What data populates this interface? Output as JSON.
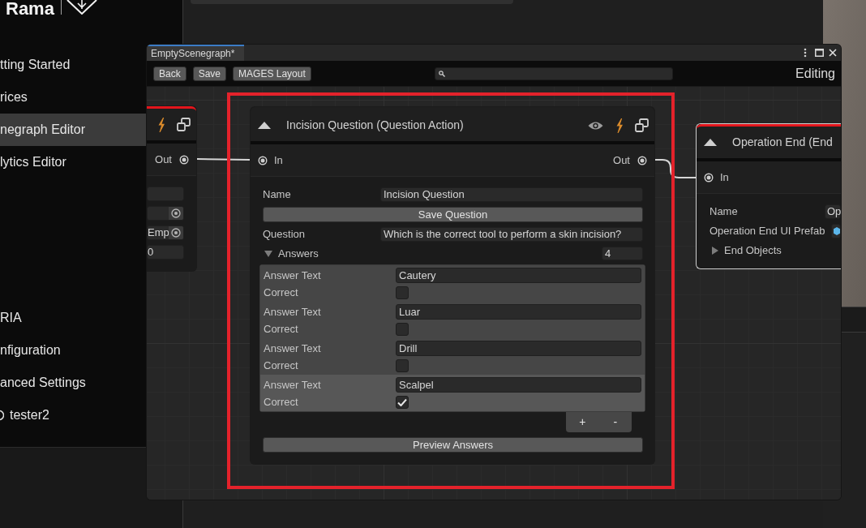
{
  "sidebar": {
    "logo_text": "Rama",
    "sections": [
      {
        "items": [
          {
            "kind": "link",
            "label": "tting Started",
            "selected": false
          },
          {
            "kind": "link",
            "label": "rices",
            "selected": false
          },
          {
            "kind": "link",
            "label": "negraph Editor",
            "selected": true
          },
          {
            "kind": "link",
            "label": "lytics Editor",
            "selected": false
          }
        ]
      },
      {
        "items": [
          {
            "kind": "link",
            "label": "RIA",
            "selected": false
          },
          {
            "kind": "link",
            "label": "nfiguration",
            "selected": false
          },
          {
            "kind": "link",
            "label": "anced Settings",
            "selected": false
          },
          {
            "kind": "user",
            "label": "tester2",
            "selected": false
          }
        ]
      }
    ]
  },
  "window": {
    "tab": "EmptyScenegraph*",
    "toolbar_buttons": [
      "Back",
      "Save",
      "MAGES Layout"
    ],
    "mode": "Editing"
  },
  "graph": {
    "nodes": [
      {
        "marked": true,
        "selected": false,
        "header_icons": [
          {
            "kind": "event"
          },
          {
            "kind": "prefab"
          }
        ],
        "ports": {
          "out": "Out"
        },
        "fields": [
          {
            "kind": "text"
          },
          {
            "kind": "object",
            "picker": true
          },
          {
            "kind": "object",
            "value": "Emp",
            "picker": true
          },
          {
            "kind": "text",
            "value": "0"
          }
        ]
      },
      {
        "title": "Incision Question (Question Action)",
        "marked": false,
        "selected": false,
        "annotated": true,
        "header_icons": [
          {
            "kind": "preview"
          },
          {
            "kind": "event"
          },
          {
            "kind": "prefab"
          }
        ],
        "ports": {
          "in": "In",
          "out": "Out"
        },
        "fields": [
          {
            "kind": "text",
            "label": "Name",
            "value": "Incision Question"
          },
          {
            "kind": "button",
            "label": "Save Question"
          },
          {
            "kind": "text",
            "label": "Question",
            "value": "Which is the correct tool to perform a skin incision?"
          },
          {
            "kind": "list",
            "label": "Answers",
            "expanded": true,
            "count": "4",
            "items": [
              {
                "text_label": "Answer Text",
                "text": "Cautery",
                "check_label": "Correct",
                "checked": false,
                "selected": false
              },
              {
                "text_label": "Answer Text",
                "text": "Luar",
                "check_label": "Correct",
                "checked": false,
                "selected": false
              },
              {
                "text_label": "Answer Text",
                "text": "Drill",
                "check_label": "Correct",
                "checked": false,
                "selected": false
              },
              {
                "text_label": "Answer Text",
                "text": "Scalpel",
                "check_label": "Correct",
                "checked": true,
                "selected": true
              }
            ],
            "add_button": "+",
            "remove_button": "-"
          },
          {
            "kind": "button",
            "label": "Preview Answers"
          }
        ]
      },
      {
        "title": "Operation End (End",
        "marked": true,
        "selected": true,
        "ports": {
          "in": "In"
        },
        "fields": [
          {
            "kind": "text",
            "label": "Name",
            "value": "Op"
          },
          {
            "kind": "object",
            "label": "Operation End UI Prefab",
            "asset_icon": true
          },
          {
            "kind": "foldout",
            "label": "End Objects",
            "expanded": false
          }
        ]
      }
    ]
  }
}
